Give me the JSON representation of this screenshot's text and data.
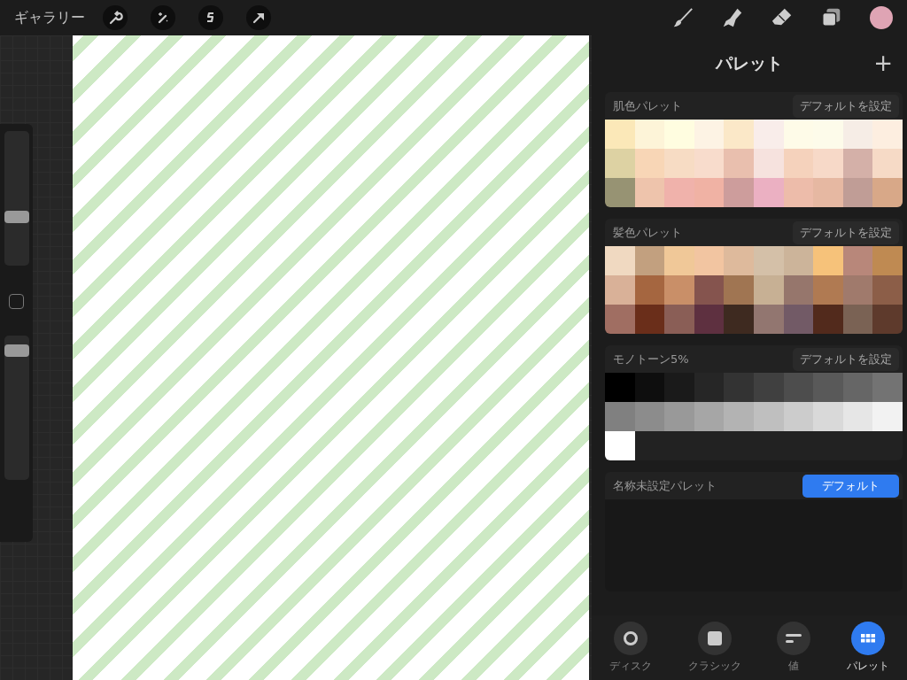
{
  "top_bar": {
    "gallery_label": "ギャラリー",
    "current_color": {
      "color": "#dfa4b4"
    }
  },
  "sidebar": {
    "size_slider": {
      "level": 0.37
    },
    "opacity_slider": {
      "level": 0.9
    }
  },
  "panel": {
    "title": "パレット",
    "add_label": "+",
    "palettes": [
      {
        "name": "肌色パレット",
        "button": "デフォルトを設定",
        "is_default": false,
        "swatches": [
          {
            "color": "#fbe8b8"
          },
          {
            "color": "#fdf4d8"
          },
          {
            "color": "#fffde0"
          },
          {
            "color": "#fdf3e4"
          },
          {
            "color": "#fbe8c8"
          },
          {
            "color": "#f9edea"
          },
          {
            "color": "#fefbe8"
          },
          {
            "color": "#fdfbea"
          },
          {
            "color": "#f6ede6"
          },
          {
            "color": "#fdeee0"
          },
          {
            "color": "#ddd2a3"
          },
          {
            "color": "#f8d6b6"
          },
          {
            "color": "#f7dcc4"
          },
          {
            "color": "#f8dccc"
          },
          {
            "color": "#e9bfae"
          },
          {
            "color": "#f6e2de"
          },
          {
            "color": "#f5d2bc"
          },
          {
            "color": "#f7d9c8"
          },
          {
            "color": "#d4b0a8"
          },
          {
            "color": "#f6dac6"
          },
          {
            "color": "#979373"
          },
          {
            "color": "#eec4ac"
          },
          {
            "color": "#f0b2ab"
          },
          {
            "color": "#f0b2a4"
          },
          {
            "color": "#cd9d9c"
          },
          {
            "color": "#ebb0c2"
          },
          {
            "color": "#edbcaa"
          },
          {
            "color": "#e6b8a2"
          },
          {
            "color": "#c09d96"
          },
          {
            "color": "#d8a888"
          }
        ]
      },
      {
        "name": "髪色パレット",
        "button": "デフォルトを設定",
        "is_default": false,
        "swatches": [
          {
            "color": "#f0d9c1"
          },
          {
            "color": "#c2a07f"
          },
          {
            "color": "#f0c898"
          },
          {
            "color": "#f2c5a1"
          },
          {
            "color": "#deba9c"
          },
          {
            "color": "#d4c0a8"
          },
          {
            "color": "#ccb49a"
          },
          {
            "color": "#f6c27a"
          },
          {
            "color": "#b8877a"
          },
          {
            "color": "#bf8a52"
          },
          {
            "color": "#d9b198"
          },
          {
            "color": "#a56640"
          },
          {
            "color": "#c98f68"
          },
          {
            "color": "#85544e"
          },
          {
            "color": "#a07552"
          },
          {
            "color": "#c7b094"
          },
          {
            "color": "#96766c"
          },
          {
            "color": "#b07a52"
          },
          {
            "color": "#a07a6c"
          },
          {
            "color": "#8c5e48"
          },
          {
            "color": "#a06e62"
          },
          {
            "color": "#6a2e1a"
          },
          {
            "color": "#8a5e56"
          },
          {
            "color": "#5e3040"
          },
          {
            "color": "#3e2a20"
          },
          {
            "color": "#927670"
          },
          {
            "color": "#725a66"
          },
          {
            "color": "#522a1c"
          },
          {
            "color": "#7a6254"
          },
          {
            "color": "#5e3a2c"
          }
        ]
      },
      {
        "name": "モノトーン5%",
        "button": "デフォルトを設定",
        "is_default": false,
        "swatches": [
          {
            "color": "#000000"
          },
          {
            "color": "#0e0e0e"
          },
          {
            "color": "#1a1a1a"
          },
          {
            "color": "#262626"
          },
          {
            "color": "#333333"
          },
          {
            "color": "#404040"
          },
          {
            "color": "#4d4d4d"
          },
          {
            "color": "#595959"
          },
          {
            "color": "#666666"
          },
          {
            "color": "#737373"
          },
          {
            "color": "#808080"
          },
          {
            "color": "#8c8c8c"
          },
          {
            "color": "#999999"
          },
          {
            "color": "#a6a6a6"
          },
          {
            "color": "#b3b3b3"
          },
          {
            "color": "#bfbfbf"
          },
          {
            "color": "#cccccc"
          },
          {
            "color": "#d9d9d9"
          },
          {
            "color": "#e6e6e6"
          },
          {
            "color": "#f2f2f2"
          },
          {
            "color": "#ffffff"
          }
        ]
      },
      {
        "name": "名称未設定パレット",
        "button": "デフォルト",
        "is_default": true
      }
    ],
    "tabs": [
      {
        "label": "ディスク",
        "kind": "disc",
        "selected": false
      },
      {
        "label": "クラシック",
        "kind": "classic",
        "selected": false
      },
      {
        "label": "値",
        "kind": "value",
        "selected": false
      },
      {
        "label": "パレット",
        "kind": "palette",
        "selected": true
      }
    ]
  }
}
